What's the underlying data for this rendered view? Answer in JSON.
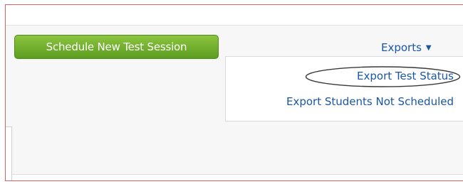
{
  "toolbar": {
    "schedule_label": "Schedule New Test Session"
  },
  "exports": {
    "label": "Exports",
    "caret_icon": "caret-down-icon",
    "menu": [
      {
        "label": "Export Test Status",
        "highlighted": true
      },
      {
        "label": "Export Students Not Scheduled",
        "highlighted": false
      }
    ]
  },
  "colors": {
    "link": "#1b56a3",
    "button_green": "#6aab2b",
    "frame_border": "#d8615a"
  }
}
